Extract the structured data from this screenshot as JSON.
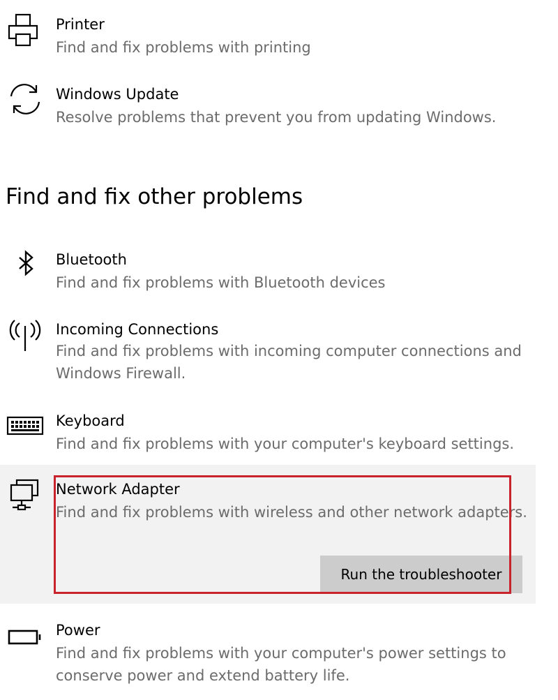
{
  "top_items": [
    {
      "title": "Printer",
      "description": "Find and fix problems with printing",
      "icon": "printer-icon"
    },
    {
      "title": "Windows Update",
      "description": "Resolve problems that prevent you from updating Windows.",
      "icon": "sync-icon"
    }
  ],
  "other_section": {
    "heading": "Find and fix other problems",
    "items": [
      {
        "title": "Bluetooth",
        "description": "Find and fix problems with Bluetooth devices",
        "icon": "bluetooth-icon"
      },
      {
        "title": "Incoming Connections",
        "description": "Find and fix problems with incoming computer connections and Windows Firewall.",
        "icon": "antenna-icon"
      },
      {
        "title": "Keyboard",
        "description": "Find and fix problems with your computer's keyboard settings.",
        "icon": "keyboard-icon"
      },
      {
        "title": "Network Adapter",
        "description": "Find and fix problems with wireless and other network adapters.",
        "icon": "network-adapter-icon",
        "selected": true
      },
      {
        "title": "Power",
        "description": "Find and fix problems with your computer's power settings to conserve power and extend battery life.",
        "icon": "battery-icon"
      }
    ]
  },
  "run_button_label": "Run the troubleshooter",
  "colors": {
    "selected_background": "#f2f2f2",
    "button_background": "#cccccc",
    "annotation_border": "#c8232c",
    "description_text": "#6b6b6b"
  }
}
